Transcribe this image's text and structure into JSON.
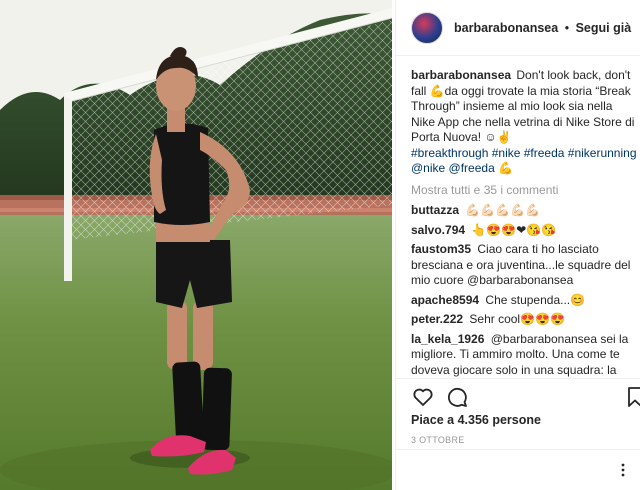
{
  "post": {
    "username": "barbarabonansea",
    "separator": "•",
    "follow_label": "Segui già"
  },
  "caption": {
    "username": "barbarabonansea",
    "text": "Don't look back, don't fall 💪da oggi trovate la mia storia “Break Through” insieme al mio look sia nella Nike App che nella vetrina di Nike Store di Porta Nuova! ☺✌",
    "hashtags": "#breakthrough #nike #freeda #nikerunning",
    "mentions": "@nike @freeda",
    "emoji_end": "💪"
  },
  "more_comments_label": "Mostra tutti e 35 i commenti",
  "comments": [
    {
      "user": "buttazza",
      "text": "💪🏻💪🏻💪🏻💪🏻💪🏻"
    },
    {
      "user": "salvo.794",
      "text": "👆😍😍❤😘😘"
    },
    {
      "user": "faustom35",
      "text": "Ciao cara ti ho lasciato bresciana e ora juventina...le squadre del mio cuore @barbarabonansea"
    },
    {
      "user": "apache8594",
      "text": "Che stupenda...😊"
    },
    {
      "user": "peter.222",
      "text": "Sehr cool😍😍😍"
    },
    {
      "user": "la_kela_1926",
      "text": "@barbarabonansea sei la migliore. Ti ammiro molto. Una come te doveva giocare solo in una squadra: la juve"
    }
  ],
  "likes_label": "Piace a 4.356 persone",
  "date_label": "3 OTTOBRE",
  "icons": {
    "like": "heart-icon",
    "comment": "comment-icon",
    "save": "bookmark-icon",
    "options": "more-options-icon"
  }
}
